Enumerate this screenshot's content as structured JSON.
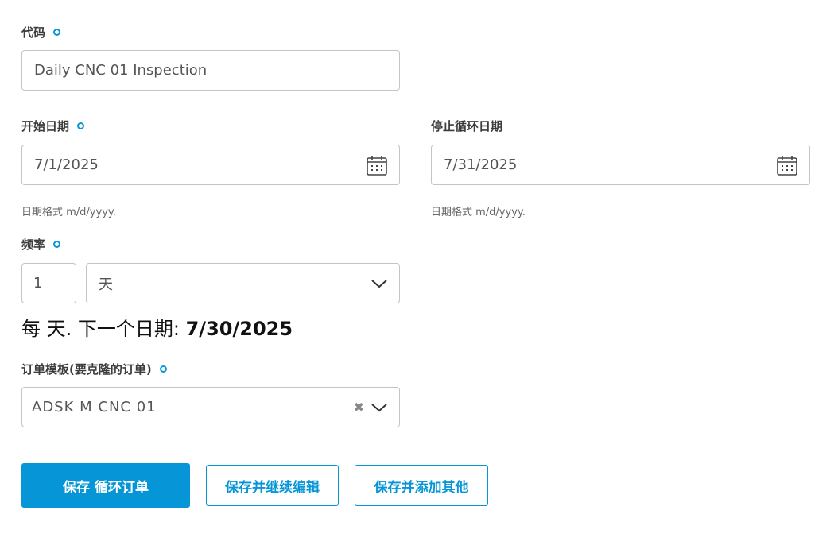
{
  "code": {
    "label": "代码",
    "value": "Daily CNC 01 Inspection"
  },
  "start_date": {
    "label": "开始日期",
    "value": "7/1/2025",
    "hint": "日期格式 m/d/yyyy.",
    "icon": "calendar-icon"
  },
  "stop_date": {
    "label": "停止循环日期",
    "value": "7/31/2025",
    "hint": "日期格式 m/d/yyyy.",
    "icon": "calendar-icon"
  },
  "frequency": {
    "label": "频率",
    "count": "1",
    "unit": "天"
  },
  "summary": {
    "prefix": "每 天. 下一个日期: ",
    "next_date": "7/30/2025"
  },
  "template": {
    "label": "订单模板(要克隆的订单)",
    "value": "ADSK M CNC 01",
    "clear": "✖"
  },
  "buttons": {
    "save": "保存 循环订单",
    "save_continue": "保存并继续编辑",
    "save_add": "保存并添加其他"
  },
  "colors": {
    "accent": "#0696d7",
    "border": "#c4c4c4"
  }
}
